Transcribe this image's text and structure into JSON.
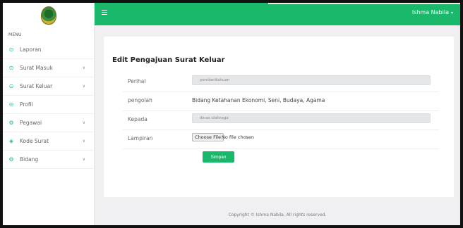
{
  "header": {
    "user_name": "Ishma Nabila",
    "caret": "▾"
  },
  "sidebar": {
    "menu_title": "MENU",
    "items": [
      {
        "label": "Laporan",
        "icon": "circle-icon",
        "has_chevron": false
      },
      {
        "label": "Surat Masuk",
        "icon": "circle-icon",
        "has_chevron": true
      },
      {
        "label": "Surat Keluar",
        "icon": "circle-icon",
        "has_chevron": true
      },
      {
        "label": "Profil",
        "icon": "circle-icon",
        "has_chevron": false
      },
      {
        "label": "Pegawai",
        "icon": "gear-icon",
        "has_chevron": true
      },
      {
        "label": "Kode Surat",
        "icon": "diamond-icon",
        "has_chevron": true
      },
      {
        "label": "Bidang",
        "icon": "gear-icon",
        "has_chevron": true
      }
    ]
  },
  "form": {
    "title": "Edit Pengajuan Surat Keluar",
    "perihal": {
      "label": "Perihal",
      "value": "pemberitahuan"
    },
    "pengolah": {
      "label": "pengolah",
      "value": "Bidang Ketahanan Ekonomi, Seni, Budaya, Agama"
    },
    "kepada": {
      "label": "Kepada",
      "value": "dinas olahraga"
    },
    "lampiran": {
      "label": "Lampiran",
      "button": "Choose File",
      "status": "No file chosen"
    },
    "submit": "Simpan"
  },
  "footer": {
    "copyright": "Copyright © Ishma Nabila. All rights reserved."
  },
  "colors": {
    "brand_green": "#19b86a",
    "content_bg": "#f0f0f2"
  }
}
